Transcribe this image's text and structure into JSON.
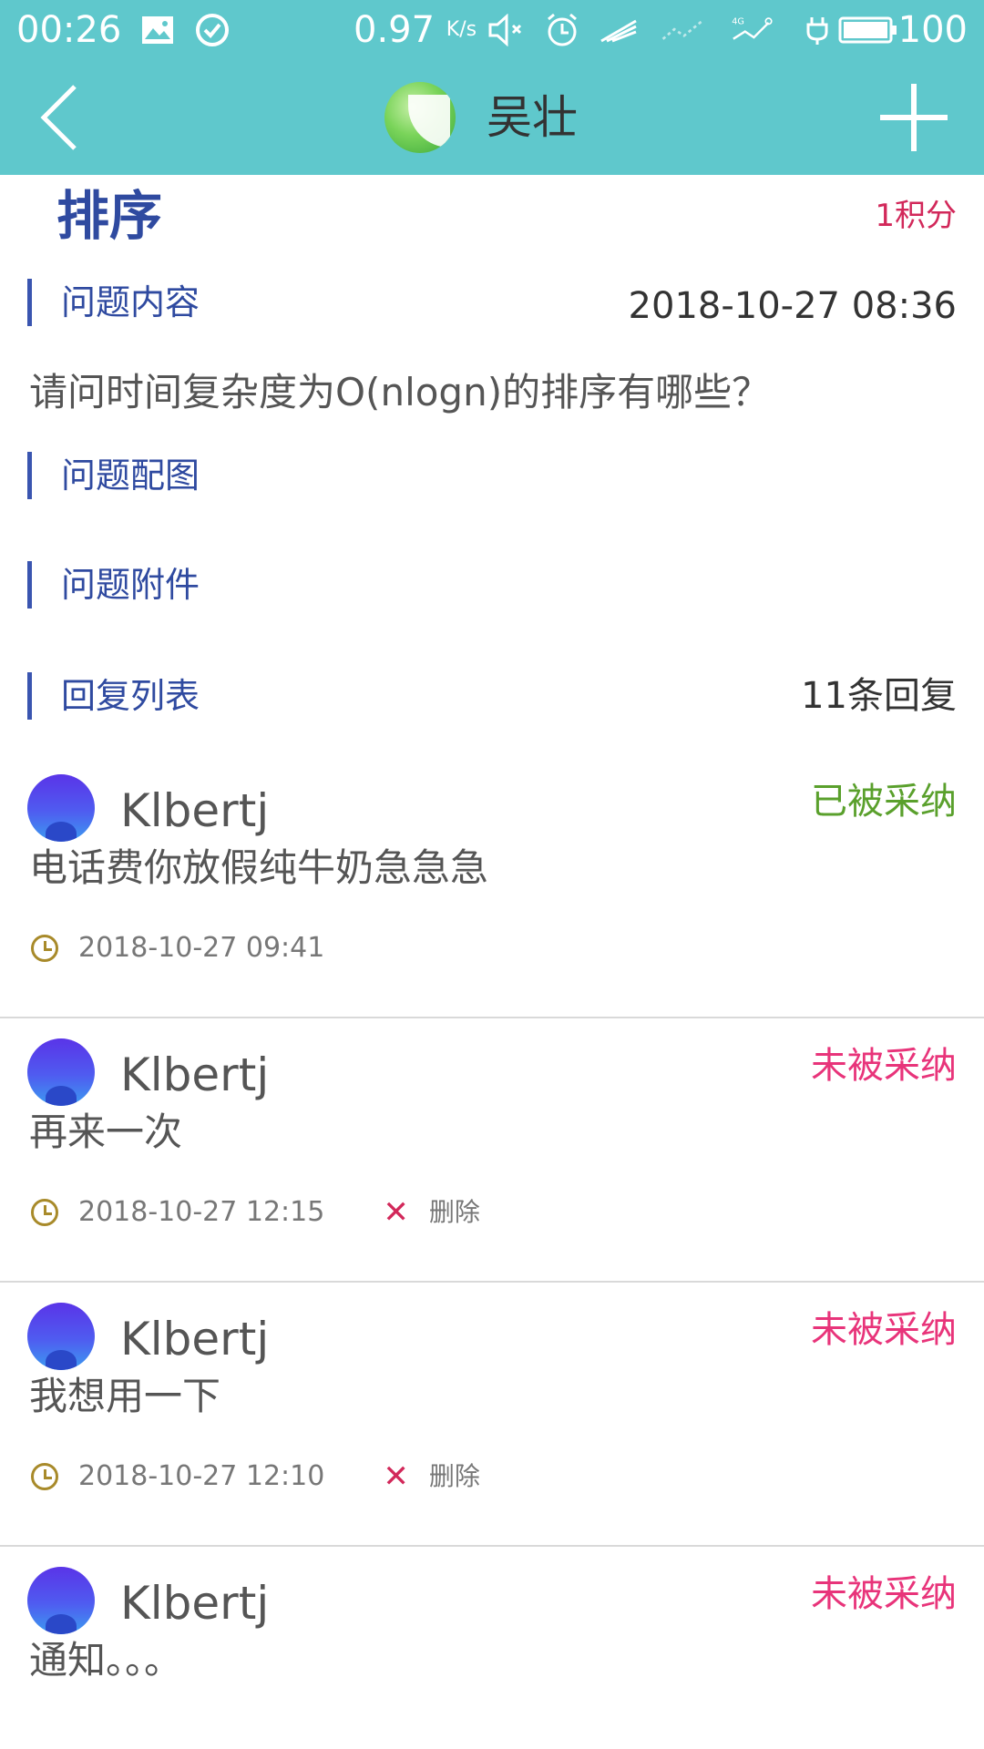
{
  "status_bar": {
    "time": "00:26",
    "net_speed": "0.97",
    "net_speed_unit": "K/s",
    "battery_level": "100",
    "icons": [
      "image-icon",
      "check-circle-icon",
      "mute-icon",
      "alarm-icon",
      "wifi-icon",
      "signal-icon",
      "signal-4g-icon",
      "charging-icon",
      "battery-icon"
    ]
  },
  "toolbar": {
    "title": "吴壮",
    "back_icon": "chevron-left-icon",
    "add_icon": "plus-icon"
  },
  "question": {
    "title": "排序",
    "points": "1积分",
    "content_label": "问题内容",
    "date": "2018-10-27 08:36",
    "content": "请问时间复杂度为O(nlogn)的排序有哪些？",
    "images_label": "问题配图",
    "attachments_label": "问题附件"
  },
  "replies_section": {
    "label": "回复列表",
    "count": "11条回复"
  },
  "replies": [
    {
      "user": "Klbertj",
      "status": "已被采纳",
      "text": "电话费你放假纯牛奶急急急",
      "time": "2018-10-27 09:41",
      "delete_label": ""
    },
    {
      "user": "Klbertj",
      "status": "未被采纳",
      "text": "再来一次",
      "time": "2018-10-27 12:15",
      "delete_label": "删除"
    },
    {
      "user": "Klbertj",
      "status": "未被采纳",
      "text": "我想用一下",
      "time": "2018-10-27 12:10",
      "delete_label": "删除"
    },
    {
      "user": "Klbertj",
      "status": "未被采纳",
      "text": "通知。。。",
      "time": "",
      "delete_label": ""
    }
  ],
  "colors": {
    "accent": "#5fc8cc",
    "section_bar": "#3a55b0",
    "accepted": "#5aa02c",
    "pending": "#e8347a"
  }
}
